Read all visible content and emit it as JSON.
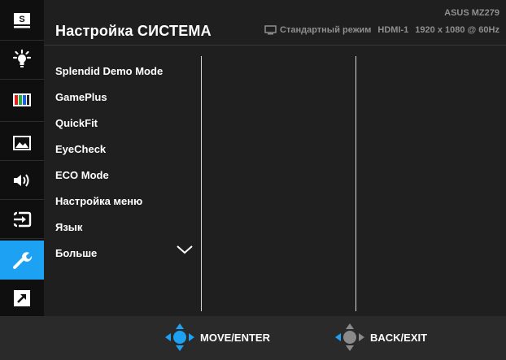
{
  "header": {
    "title": "Настройка СИСТЕМА",
    "model": "ASUS MZ279",
    "mode": "Стандартный режим",
    "input": "HDMI-1",
    "resolution": "1920 x 1080 @ 60Hz"
  },
  "sidebar": {
    "items": [
      {
        "name": "splendid",
        "icon": "s-splendid-icon"
      },
      {
        "name": "blue-light-filter",
        "icon": "blue-light-icon"
      },
      {
        "name": "color",
        "icon": "color-bars-icon"
      },
      {
        "name": "image",
        "icon": "image-icon"
      },
      {
        "name": "sound",
        "icon": "speaker-icon"
      },
      {
        "name": "input-select",
        "icon": "input-icon"
      },
      {
        "name": "system-setup",
        "icon": "wrench-icon",
        "active": true
      },
      {
        "name": "shortcut",
        "icon": "arrow-icon"
      }
    ]
  },
  "menu": {
    "items": [
      "Splendid Demo Mode",
      "GamePlus",
      "QuickFit",
      "EyeCheck",
      "ECO Mode",
      "Настройка меню",
      "Язык",
      "Больше"
    ]
  },
  "footer": {
    "move_label": "MOVE/ENTER",
    "back_label": "BACK/EXIT"
  },
  "colors": {
    "accent": "#1da1f2",
    "background": "#1e1e1e",
    "text": "#ffffff",
    "muted": "#8f8f8f"
  }
}
